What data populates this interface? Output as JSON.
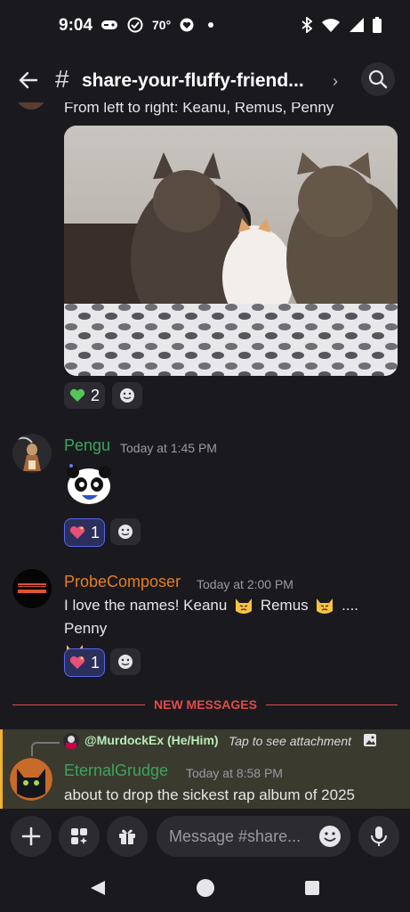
{
  "status_bar": {
    "time": "9:04",
    "temperature": "70°"
  },
  "header": {
    "channel_title": "share-your-fluffy-friend..."
  },
  "messages": [
    {
      "caption_cut": "From left to right: Keanu, Remus, Penny",
      "reactions": [
        {
          "emoji": "green-heart",
          "count": "2"
        }
      ]
    },
    {
      "username": "Pengu",
      "username_color": "#3ba55c",
      "timestamp": "Today at 1:45 PM",
      "reactions": [
        {
          "emoji": "sparkling-heart",
          "count": "1"
        }
      ]
    },
    {
      "username": "ProbeComposer",
      "username_color": "#e67e22",
      "timestamp": "Today at 2:00 PM",
      "text_parts": [
        "I love the names! Keanu",
        "Remus",
        ".... Penny"
      ],
      "reactions": [
        {
          "emoji": "sparkling-heart",
          "count": "1"
        }
      ]
    }
  ],
  "new_messages_label": "NEW MESSAGES",
  "reply": {
    "reply_to": "@MurdockEx (He/Him)",
    "reply_hint": "Tap to see attachment",
    "username": "EternalGrudge",
    "username_color": "#3ba55c",
    "timestamp": "Today at 8:58 PM",
    "text": "about to drop the sickest rap album of 2025"
  },
  "composer": {
    "placeholder": "Message #share..."
  },
  "colors": {
    "accent": "#5865f2",
    "new_messages": "#e24a4a",
    "highlight": "#3b3a2f",
    "highlight_bar": "#f0b232"
  }
}
